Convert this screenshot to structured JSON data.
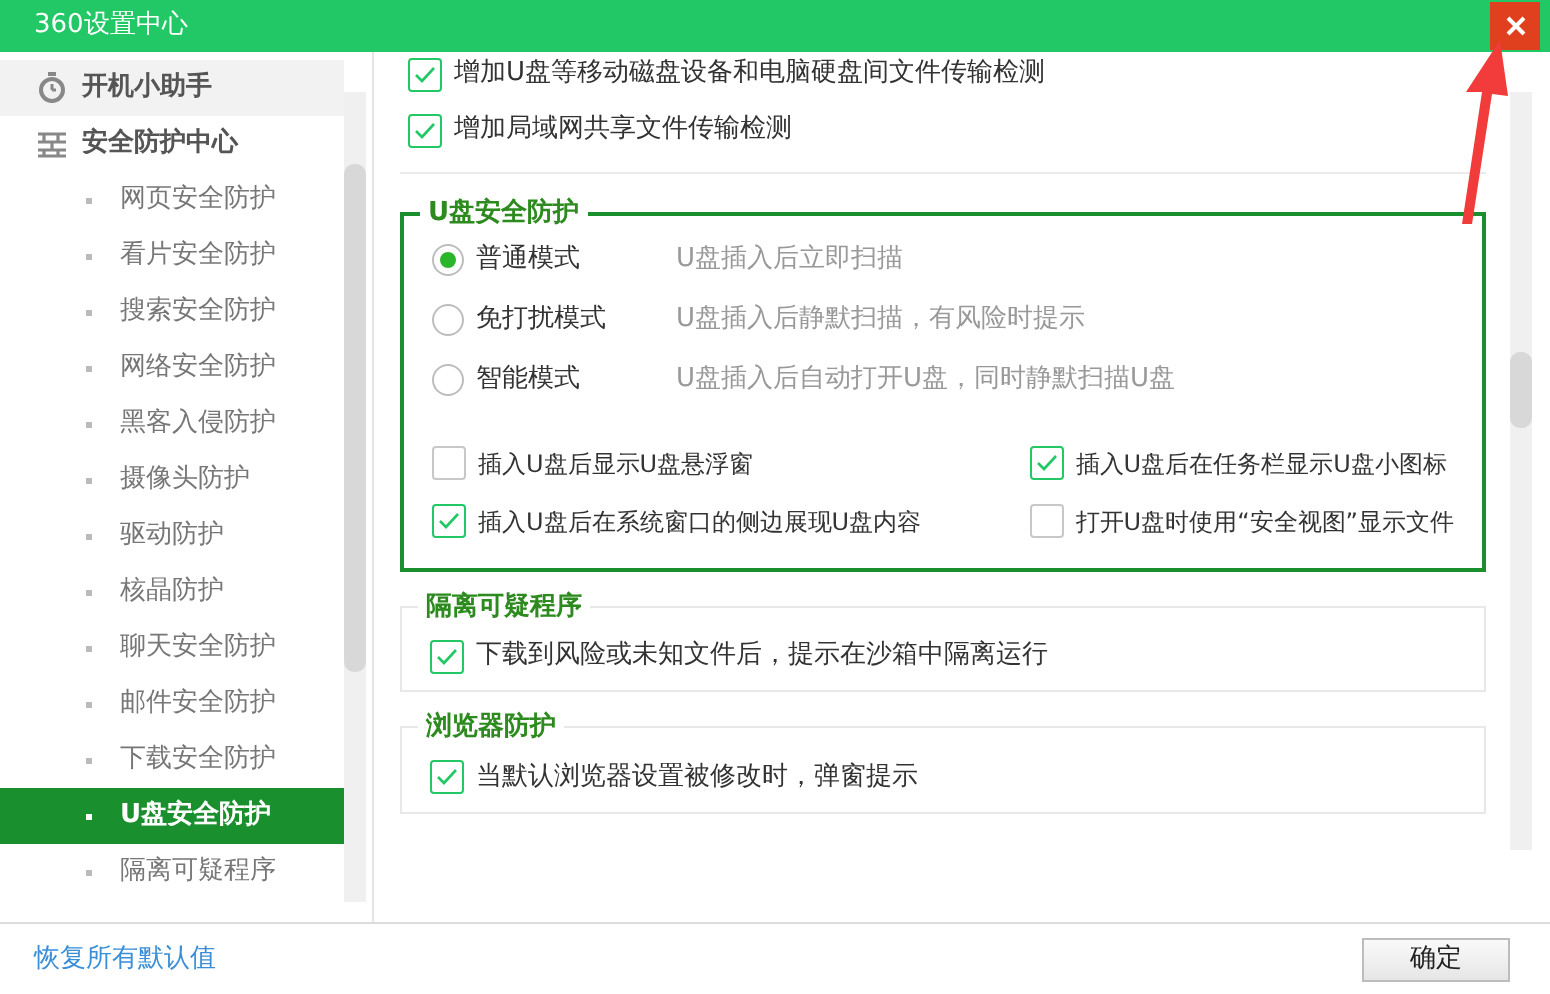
{
  "window": {
    "title": "360设置中心"
  },
  "sidebar": {
    "sections": [
      {
        "kind": "timer",
        "label": "开机小助手",
        "selected": false
      },
      {
        "kind": "shield",
        "label": "安全防护中心",
        "selected": false,
        "children": [
          {
            "label": "网页安全防护",
            "selected": false
          },
          {
            "label": "看片安全防护",
            "selected": false
          },
          {
            "label": "搜索安全防护",
            "selected": false
          },
          {
            "label": "网络安全防护",
            "selected": false
          },
          {
            "label": "黑客入侵防护",
            "selected": false
          },
          {
            "label": "摄像头防护",
            "selected": false
          },
          {
            "label": "驱动防护",
            "selected": false
          },
          {
            "label": "核晶防护",
            "selected": false
          },
          {
            "label": "聊天安全防护",
            "selected": false
          },
          {
            "label": "邮件安全防护",
            "selected": false
          },
          {
            "label": "下载安全防护",
            "selected": false
          },
          {
            "label": "U盘安全防护",
            "selected": true
          },
          {
            "label": "隔离可疑程序",
            "selected": false
          }
        ]
      }
    ]
  },
  "top_options": [
    {
      "label": "增加U盘等移动磁盘设备和电脑硬盘间文件传输检测",
      "checked": true
    },
    {
      "label": "增加局域网共享文件传输检测",
      "checked": true
    }
  ],
  "sections": [
    {
      "title": "U盘安全防护",
      "highlighted": true,
      "modes": [
        {
          "label": "普通模式",
          "description": "U盘插入后立即扫描",
          "selected": true
        },
        {
          "label": "免打扰模式",
          "description": "U盘插入后静默扫描，有风险时提示",
          "selected": false
        },
        {
          "label": "智能模式",
          "description": "U盘插入后自动打开U盘，同时静默扫描U盘",
          "selected": false
        }
      ],
      "options": [
        {
          "label": "插入U盘后显示U盘悬浮窗",
          "checked": false
        },
        {
          "label": "插入U盘后在任务栏显示U盘小图标",
          "checked": true
        },
        {
          "label": "插入U盘后在系统窗口的侧边展现U盘内容",
          "checked": true
        },
        {
          "label": "打开U盘时使用“安全视图”显示文件",
          "checked": false
        }
      ]
    },
    {
      "title": "隔离可疑程序",
      "highlighted": false,
      "options": [
        {
          "label": "下载到风险或未知文件后，提示在沙箱中隔离运行",
          "checked": true
        }
      ]
    },
    {
      "title": "浏览器防护",
      "highlighted": false,
      "options": [
        {
          "label": "当默认浏览器设置被修改时，弹窗提示",
          "checked": true
        }
      ]
    }
  ],
  "footer": {
    "restore_link": "恢复所有默认值",
    "ok_button": "确定"
  }
}
